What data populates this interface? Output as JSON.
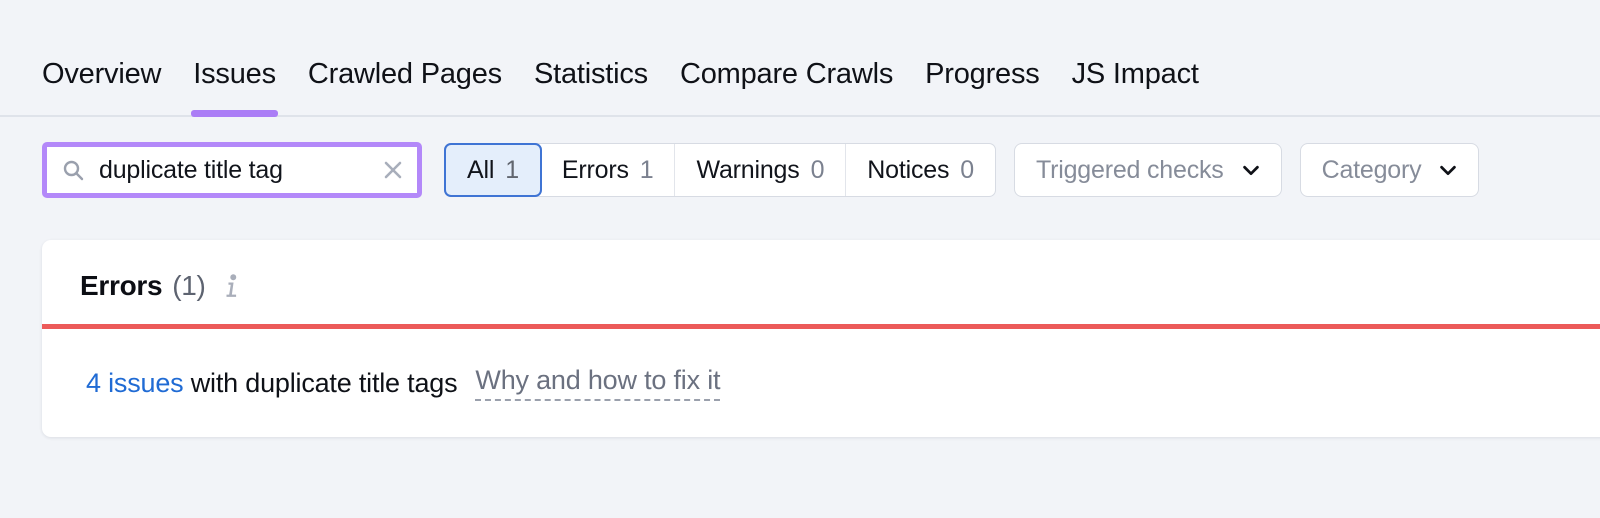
{
  "theme": {
    "page_bg": "#f2f4f8",
    "accent_purple": "#ab7df6",
    "accent_blue": "#206bd4",
    "error_red": "#ec5a59",
    "card_bg": "#ffffff"
  },
  "tabs": [
    {
      "label": "Overview",
      "active": false
    },
    {
      "label": "Issues",
      "active": true
    },
    {
      "label": "Crawled Pages",
      "active": false
    },
    {
      "label": "Statistics",
      "active": false
    },
    {
      "label": "Compare Crawls",
      "active": false
    },
    {
      "label": "Progress",
      "active": false
    },
    {
      "label": "JS Impact",
      "active": false
    }
  ],
  "search": {
    "value": "duplicate title tag",
    "placeholder": "Search",
    "icon": "search-icon",
    "clear_icon": "close-icon"
  },
  "segments": [
    {
      "label": "All",
      "count": "1",
      "active": true
    },
    {
      "label": "Errors",
      "count": "1",
      "active": false
    },
    {
      "label": "Warnings",
      "count": "0",
      "active": false
    },
    {
      "label": "Notices",
      "count": "0",
      "active": false
    }
  ],
  "dropdowns": [
    {
      "label": "Triggered checks",
      "icon": "chevron-down-icon"
    },
    {
      "label": "Category",
      "icon": "chevron-down-icon"
    }
  ],
  "card": {
    "title": "Errors",
    "count": "(1)",
    "info_icon": "info-icon",
    "issue": {
      "link_text": "4 issues",
      "description": " with duplicate title tags",
      "fix_link": "Why and how to fix it"
    }
  }
}
